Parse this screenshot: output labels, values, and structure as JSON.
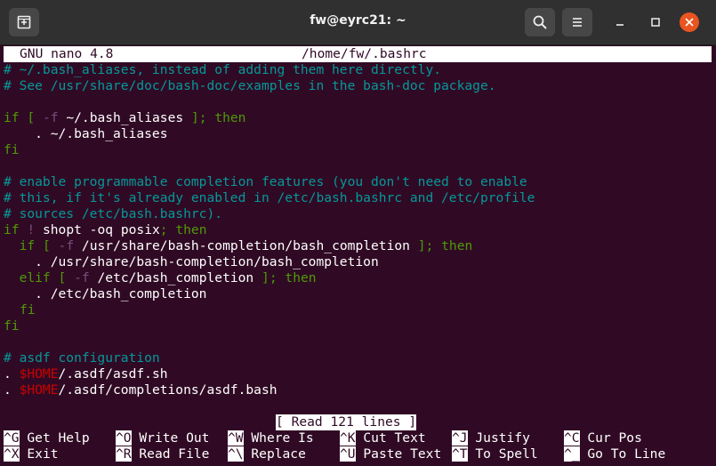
{
  "window": {
    "title": "fw@eyrc21: ~"
  },
  "icons": {
    "new_tab": "new-tab-icon",
    "search": "search-icon",
    "menu": "hamburger-menu-icon",
    "minimize": "minimize-icon",
    "maximize": "maximize-icon",
    "close": "close-icon"
  },
  "colors": {
    "terminal_bg": "#300a24",
    "comment": "#06989a",
    "keyword": "#4e9a06",
    "flag": "#75507b",
    "variable": "#cc0000",
    "close_button": "#e95420"
  },
  "nano": {
    "version": "GNU nano 4.8",
    "file": "/home/fw/.bashrc",
    "status": "[ Read 121 lines ]"
  },
  "content": {
    "l1": "# ~/.bash_aliases, instead of adding them here directly.",
    "l2": "# See /usr/share/doc/bash-doc/examples in the bash-doc package.",
    "l4_if": "if",
    "l4_open": "[",
    "l4_flag": "-f",
    "l4_path": "~/.bash_aliases",
    "l4_close": "];",
    "l4_then": "then",
    "l5": "    . ~/.bash_aliases",
    "l6": "fi",
    "l8": "# enable programmable completion features (you don't need to enable",
    "l9": "# this, if it's already enabled in /etc/bash.bashrc and /etc/profile",
    "l10": "# sources /etc/bash.bashrc).",
    "l11_if": "if",
    "l11_not": "!",
    "l11_cmd": "shopt -oq posix",
    "l11_semi": ";",
    "l11_then": "then",
    "l12_if": "if",
    "l12_open": "[",
    "l12_flag": "-f",
    "l12_path": "/usr/share/bash-completion/bash_completion",
    "l12_close": "];",
    "l12_then": "then",
    "l13": "    . /usr/share/bash-completion/bash_completion",
    "l14_elif": "elif",
    "l14_open": "[",
    "l14_flag": "-f",
    "l14_path": "/etc/bash_completion",
    "l14_close": "];",
    "l14_then": "then",
    "l15": "    . /etc/bash_completion",
    "l16": "fi",
    "l17": "fi",
    "l19": "# asdf configuration",
    "l20_dot": ". ",
    "l20_var": "$HOME",
    "l20_rest": "/.asdf/asdf.sh",
    "l21_dot": ". ",
    "l21_var": "$HOME",
    "l21_rest": "/.asdf/completions/asdf.bash"
  },
  "shortcuts": [
    {
      "key": "^G",
      "label": "Get Help"
    },
    {
      "key": "^O",
      "label": "Write Out"
    },
    {
      "key": "^W",
      "label": "Where Is"
    },
    {
      "key": "^K",
      "label": "Cut Text"
    },
    {
      "key": "^J",
      "label": "Justify"
    },
    {
      "key": "^C",
      "label": "Cur Pos"
    },
    {
      "key": "^X",
      "label": "Exit"
    },
    {
      "key": "^R",
      "label": "Read File"
    },
    {
      "key": "^\\",
      "label": "Replace"
    },
    {
      "key": "^U",
      "label": "Paste Text"
    },
    {
      "key": "^T",
      "label": "To Spell"
    },
    {
      "key": "^_",
      "label": "Go To Line"
    }
  ]
}
